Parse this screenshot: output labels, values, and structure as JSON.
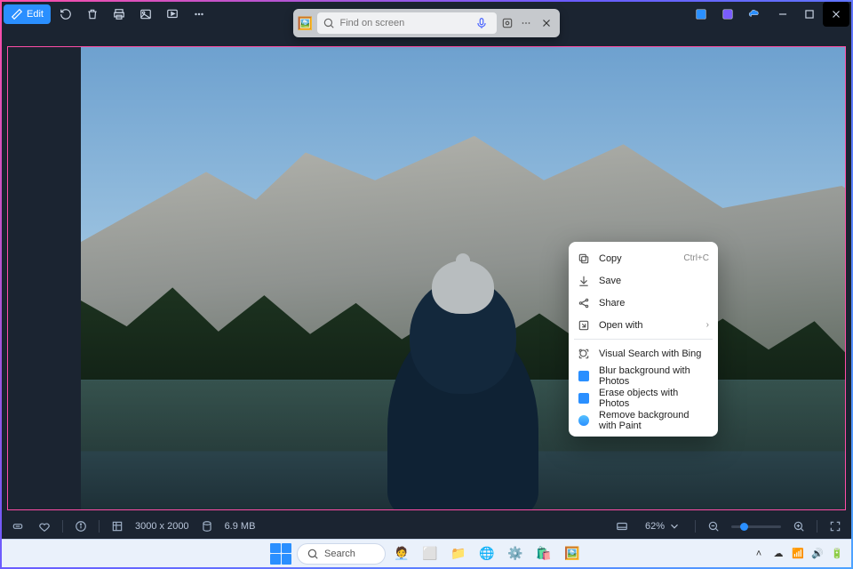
{
  "titlebar": {
    "edit_label": "Edit"
  },
  "search": {
    "placeholder": "Find on screen"
  },
  "status": {
    "dimensions": "3000 x 2000",
    "filesize": "6.9 MB",
    "zoom": "62%"
  },
  "context_menu": {
    "items": [
      {
        "icon": "copy-icon",
        "label": "Copy",
        "shortcut": "Ctrl+C"
      },
      {
        "icon": "save-icon",
        "label": "Save"
      },
      {
        "icon": "share-icon",
        "label": "Share"
      },
      {
        "icon": "open-with-icon",
        "label": "Open with",
        "submenu": true
      },
      {
        "sep": true
      },
      {
        "icon": "visual-search-icon",
        "label": "Visual Search with Bing"
      },
      {
        "icon": "photos-app-icon",
        "label": "Blur background with Photos"
      },
      {
        "icon": "photos-app-icon",
        "label": "Erase objects with Photos"
      },
      {
        "icon": "paint-app-icon",
        "label": "Remove background with Paint"
      }
    ]
  },
  "taskbar": {
    "search_label": "Search"
  }
}
